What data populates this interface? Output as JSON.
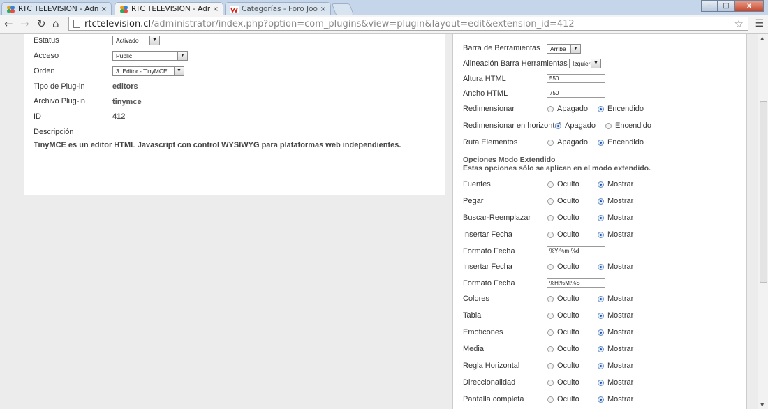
{
  "browser": {
    "tabs": [
      {
        "title": "RTC TELEVISION - Admini",
        "close": "×"
      },
      {
        "title": "RTC TELEVISION - Admini",
        "close": "×"
      },
      {
        "title": "Categorías - Foro Joomla!",
        "close": "×"
      }
    ],
    "url_domain": "rtctelevision.cl",
    "url_path": "/administrator/index.php?option=com_plugins&view=plugin&layout=edit&extension_id=412",
    "window_buttons": {
      "minimize": "–",
      "maximize": "□",
      "close": "x"
    }
  },
  "details": {
    "estatus": {
      "label": "Estatus",
      "value": "Activado"
    },
    "acceso": {
      "label": "Acceso",
      "value": "Public"
    },
    "orden": {
      "label": "Orden",
      "value": "3. Editor - TinyMCE"
    },
    "tipo": {
      "label": "Tipo de Plug-in",
      "value": "editors"
    },
    "archivo": {
      "label": "Archivo Plug-in",
      "value": "tinymce"
    },
    "id": {
      "label": "ID",
      "value": "412"
    },
    "descripcion": {
      "label": "Descripción",
      "value": "TinyMCE es un editor HTML Javascript con control WYSIWYG para plataformas web independientes."
    }
  },
  "options": {
    "barra": {
      "label": "Barra de Berramientas",
      "value": "Arriba"
    },
    "alineacion": {
      "label": "Alineación Barra Herramientas",
      "value": "Izquierda"
    },
    "altura": {
      "label": "Altura HTML",
      "value": "550"
    },
    "ancho": {
      "label": "Ancho HTML",
      "value": "750"
    },
    "redimensionar": {
      "label": "Redimensionar",
      "off": "Apagado",
      "on": "Encendido",
      "selected": "Encendido"
    },
    "redim_horizontal": {
      "label": "Redimensionar en horizontal",
      "off": "Apagado",
      "on": "Encendido",
      "selected": "Apagado"
    },
    "ruta": {
      "label": "Ruta Elementos",
      "off": "Apagado",
      "on": "Encendido",
      "selected": "Encendido"
    },
    "extended_title": "Opciones Modo Extendido",
    "extended_note": "Estas opciones sólo se aplican en el modo extendido.",
    "hide_label": "Oculto",
    "show_label": "Mostrar",
    "extended": [
      {
        "label": "Fuentes",
        "selected": "Mostrar"
      },
      {
        "label": "Pegar",
        "selected": "Mostrar"
      },
      {
        "label": "Buscar-Reemplazar",
        "selected": "Mostrar"
      },
      {
        "label": "Insertar Fecha",
        "selected": "Mostrar"
      },
      {
        "label": "Formato Fecha",
        "input": "%Y-%m-%d"
      },
      {
        "label": "Insertar Fecha",
        "selected": "Mostrar"
      },
      {
        "label": "Formato Fecha",
        "input": "%H:%M:%S"
      },
      {
        "label": "Colores",
        "selected": "Mostrar"
      },
      {
        "label": "Tabla",
        "selected": "Mostrar"
      },
      {
        "label": "Emoticones",
        "selected": "Mostrar"
      },
      {
        "label": "Media",
        "selected": "Mostrar"
      },
      {
        "label": "Regla Horizontal",
        "selected": "Mostrar"
      },
      {
        "label": "Direccionalidad",
        "selected": "Mostrar"
      },
      {
        "label": "Pantalla completa",
        "selected": "Mostrar"
      }
    ]
  }
}
